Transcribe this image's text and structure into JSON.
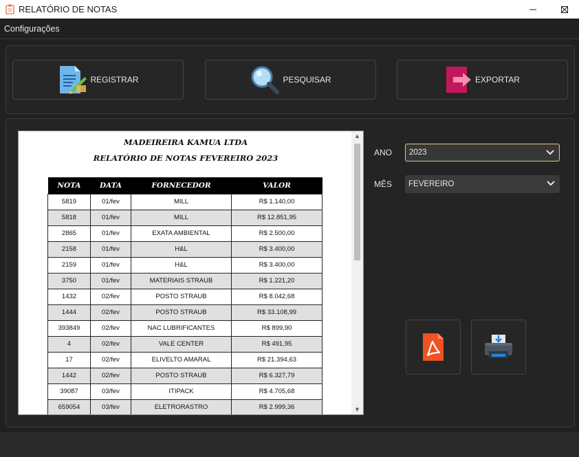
{
  "window": {
    "title": "RELATÓRIO DE NOTAS",
    "minimize_icon": "minimize-icon",
    "maximize_icon": "maximize-icon",
    "close_icon": "close-icon"
  },
  "menu": {
    "items": [
      {
        "label": "Configurações"
      }
    ]
  },
  "actions": {
    "registrar": {
      "label": "REGISTRAR",
      "icon": "document-edit-icon"
    },
    "pesquisar": {
      "label": "PESQUISAR",
      "icon": "magnifier-icon"
    },
    "exportar": {
      "label": "EXPORTAR",
      "icon": "export-arrow-icon"
    }
  },
  "report": {
    "company": "MADEIREIRA KAMUA LTDA",
    "title": "RELATÓRIO DE NOTAS FEVEREIRO 2023",
    "columns": [
      "NOTA",
      "DATA",
      "FORNECEDOR",
      "VALOR"
    ],
    "rows": [
      [
        "5819",
        "01/fev",
        "MILL",
        "R$ 1.140,00"
      ],
      [
        "5818",
        "01/fev",
        "MILL",
        "R$ 12.851,95"
      ],
      [
        "2865",
        "01/fev",
        "EXATA AMBIENTAL",
        "R$ 2.500,00"
      ],
      [
        "2158",
        "01/fev",
        "H&L",
        "R$ 3.400,00"
      ],
      [
        "2159",
        "01/fev",
        "H&L",
        "R$ 3.400,00"
      ],
      [
        "3750",
        "01/fev",
        "MATERIAIS STRAUB",
        "R$ 1.221,20"
      ],
      [
        "1432",
        "02/fev",
        "POSTO STRAUB",
        "R$ 8.042,68"
      ],
      [
        "1444",
        "02/fev",
        "POSTO STRAUB",
        "R$ 33.108,99"
      ],
      [
        "393849",
        "02/fev",
        "NAC LUBRIFICANTES",
        "R$ 899,90"
      ],
      [
        "4",
        "02/fev",
        "VALE CENTER",
        "R$ 491,95"
      ],
      [
        "17",
        "02/fev",
        "ELIVELTO AMARAL",
        "R$ 21.394,63"
      ],
      [
        "1442",
        "02/fev",
        "POSTO STRAUB",
        "R$ 6.327,79"
      ],
      [
        "39087",
        "03/fev",
        "ITIPACK",
        "R$ 4.705,68"
      ],
      [
        "659054",
        "03/fev",
        "ELETRORASTRO",
        "R$ 2.999,36"
      ]
    ]
  },
  "filters": {
    "ano": {
      "label": "ANO",
      "value": "2023"
    },
    "mes": {
      "label": "MÊS",
      "value": "FEVEREIRO"
    }
  },
  "output_buttons": {
    "pdf_icon": "pdf-icon",
    "print_icon": "printer-icon"
  },
  "colors": {
    "background": "#202020",
    "panel": "#242424",
    "pdf_red": "#f05223",
    "export_crimson": "#c2185b",
    "focus_border": "#e6c98c"
  }
}
